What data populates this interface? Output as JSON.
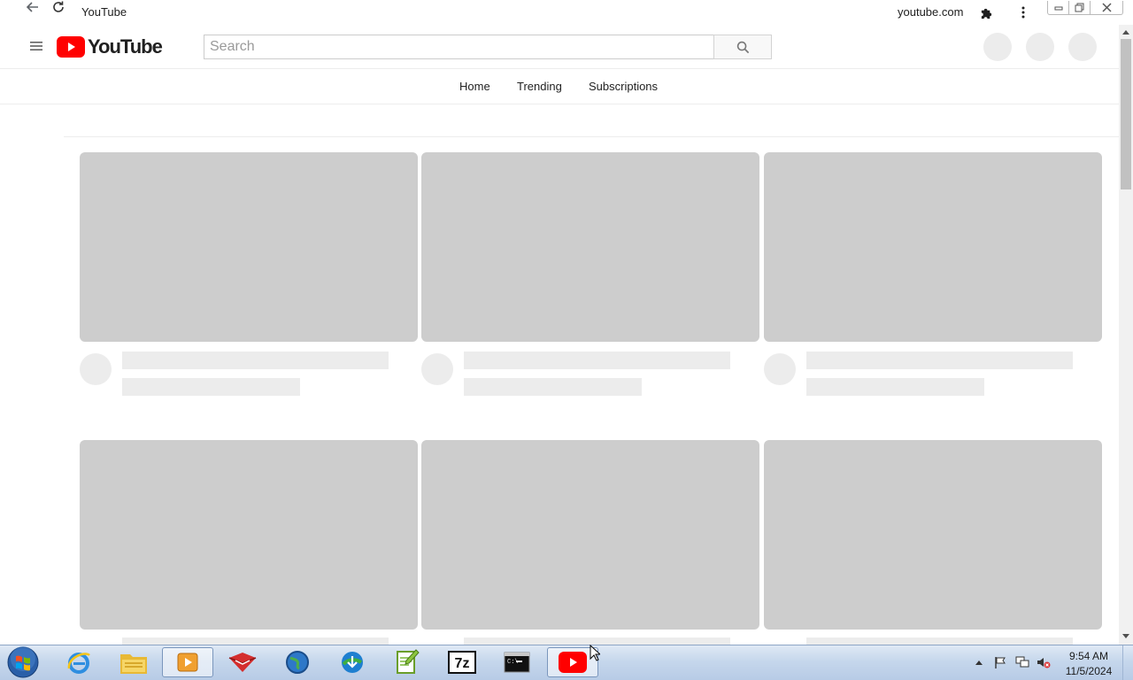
{
  "window": {
    "title": "YouTube",
    "domain": "youtube.com"
  },
  "masthead": {
    "logo_text": "YouTube",
    "search_placeholder": "Search",
    "brand_color": "#ff0000"
  },
  "tabs": [
    {
      "label": "Home"
    },
    {
      "label": "Trending"
    },
    {
      "label": "Subscriptions"
    }
  ],
  "feed": {
    "state": "loading-skeleton",
    "skeleton_cards_visible": 6
  },
  "taskbar": {
    "apps": [
      {
        "icon": "internet-explorer-icon"
      },
      {
        "icon": "file-explorer-icon"
      },
      {
        "icon": "media-player-icon",
        "active": true
      },
      {
        "icon": "red-app-icon"
      },
      {
        "icon": "globe-app-icon"
      },
      {
        "icon": "download-manager-icon"
      },
      {
        "icon": "notepad-plus-plus-icon"
      },
      {
        "icon": "7zip-icon",
        "text": "7z"
      },
      {
        "icon": "command-prompt-icon",
        "text": "C:\\"
      },
      {
        "icon": "youtube-icon",
        "active": true
      }
    ],
    "clock_time": "9:54 AM",
    "clock_date": "11/5/2024"
  }
}
